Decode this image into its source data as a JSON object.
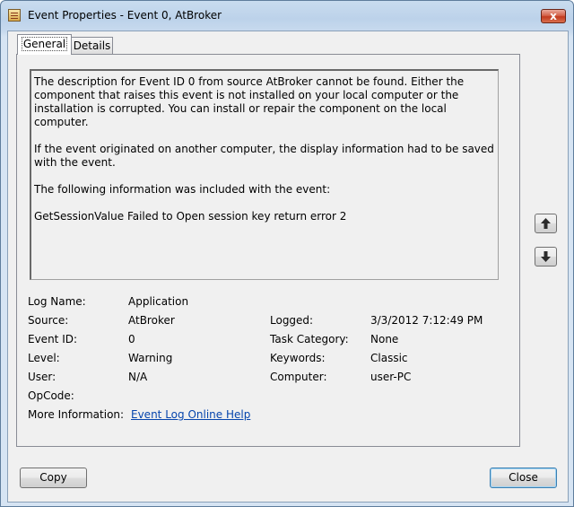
{
  "window": {
    "title": "Event Properties - Event 0, AtBroker",
    "close_glyph": "x"
  },
  "tabs": [
    {
      "label": "General",
      "active": true
    },
    {
      "label": "Details",
      "active": false
    }
  ],
  "description": {
    "paragraphs": [
      "The description for Event ID 0 from source AtBroker cannot be found. Either the component that raises this event is not installed on your local computer or the installation is corrupted. You can install or repair the component on the local computer.",
      "If the event originated on another computer, the display information had to be saved with the event.",
      "The following information was included with the event:",
      "GetSessionValue Failed to Open session key return error 2"
    ]
  },
  "fields": {
    "log_name": {
      "label": "Log Name:",
      "value": "Application"
    },
    "source": {
      "label": "Source:",
      "value": "AtBroker"
    },
    "logged": {
      "label": "Logged:",
      "value": "3/3/2012 7:12:49 PM"
    },
    "event_id": {
      "label": "Event ID:",
      "value": "0"
    },
    "task_category": {
      "label": "Task Category:",
      "value": "None"
    },
    "level": {
      "label": "Level:",
      "value": "Warning"
    },
    "keywords": {
      "label": "Keywords:",
      "value": "Classic"
    },
    "user": {
      "label": "User:",
      "value": "N/A"
    },
    "computer": {
      "label": "Computer:",
      "value": "user-PC"
    },
    "opcode": {
      "label": "OpCode:",
      "value": ""
    },
    "more_info": {
      "label": "More Information:",
      "link": "Event Log Online Help"
    }
  },
  "side_buttons": {
    "up_icon": "arrow-up-icon",
    "down_icon": "arrow-down-icon"
  },
  "buttons": {
    "copy": "Copy",
    "close": "Close"
  }
}
